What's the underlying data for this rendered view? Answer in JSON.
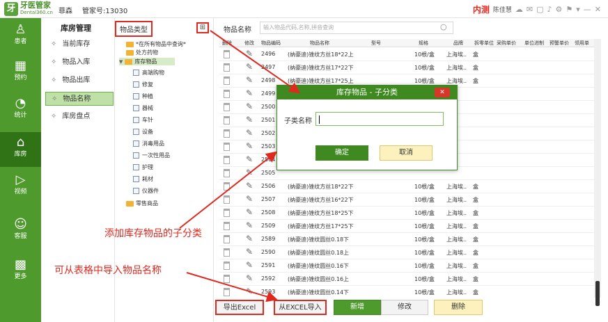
{
  "topbar": {
    "logo_main": "牙医管家",
    "logo_sub": "Dental360.cn",
    "user": "菲森",
    "account": "管家号:13030",
    "env_badge": "内测",
    "username": "陈佳慧",
    "icons": [
      "chat-icon",
      "message-icon",
      "window-icon",
      "bell-icon",
      "settings-icon",
      "signal-icon",
      "wifi-icon",
      "minimize-icon",
      "close-icon"
    ]
  },
  "nav": {
    "items": [
      {
        "label": "患者",
        "icon": "person-icon"
      },
      {
        "label": "预约",
        "icon": "calendar-icon"
      },
      {
        "label": "统计",
        "icon": "pie-chart-icon"
      },
      {
        "label": "库房",
        "icon": "warehouse-icon"
      },
      {
        "label": "视频",
        "icon": "play-icon"
      },
      {
        "label": "客服",
        "icon": "support-icon"
      },
      {
        "label": "更多",
        "icon": "grid-icon"
      }
    ]
  },
  "sub": {
    "title": "库房管理",
    "items": [
      "当前库存",
      "物品入库",
      "物品出库",
      "物品名称",
      "库房盘点"
    ]
  },
  "tree": {
    "title": "物品类型",
    "nodes": [
      {
        "label": "*在所有物品中查询*",
        "type": "folder"
      },
      {
        "label": "处方药物",
        "type": "folder"
      },
      {
        "label": "库存物品",
        "type": "folder"
      },
      {
        "label": "高端购物",
        "type": "page"
      },
      {
        "label": "修复",
        "type": "page"
      },
      {
        "label": "种植",
        "type": "page"
      },
      {
        "label": "器械",
        "type": "page"
      },
      {
        "label": "车针",
        "type": "page"
      },
      {
        "label": "设备",
        "type": "page"
      },
      {
        "label": "消毒用品",
        "type": "page"
      },
      {
        "label": "一次性用品",
        "type": "page"
      },
      {
        "label": "护理",
        "type": "page"
      },
      {
        "label": "耗材",
        "type": "page"
      },
      {
        "label": "仪器件",
        "type": "page"
      },
      {
        "label": "零售商品",
        "type": "folder"
      }
    ]
  },
  "main": {
    "search_label": "物品名称",
    "search_placeholder": "输入物品代码,名称,拼音查询",
    "headers": [
      "删除",
      "修改",
      "物品编码",
      "物品名称",
      "型号",
      "规格",
      "品牌",
      "拆零单位",
      "采购单价",
      "单位进制",
      "预警单价",
      "领用单"
    ],
    "rows": [
      {
        "code": "2496",
        "name": "(纳豪迪)锉纹方丝18*22上",
        "spec": "10根/盒",
        "brand": "上海埃..",
        "unit": "盒"
      },
      {
        "code": "2497",
        "name": "(纳豪迪)锉纹方丝17*22下",
        "spec": "10根/盒",
        "brand": "上海埃..",
        "unit": "盒"
      },
      {
        "code": "2498",
        "name": "(纳豪迪)锉纹方丝17*25上",
        "spec": "10根/盒",
        "brand": "上海埃..",
        "unit": "盒"
      },
      {
        "code": "2499",
        "name": "",
        "spec": "",
        "brand": "",
        "unit": ""
      },
      {
        "code": "2500",
        "name": "",
        "spec": "",
        "brand": "",
        "unit": ""
      },
      {
        "code": "2501",
        "name": "",
        "spec": "",
        "brand": "",
        "unit": ""
      },
      {
        "code": "2502",
        "name": "",
        "spec": "",
        "brand": "",
        "unit": ""
      },
      {
        "code": "2503",
        "name": "",
        "spec": "",
        "brand": "",
        "unit": ""
      },
      {
        "code": "2504",
        "name": "",
        "spec": "",
        "brand": "",
        "unit": ""
      },
      {
        "code": "2505",
        "name": "",
        "spec": "",
        "brand": "",
        "unit": ""
      },
      {
        "code": "2506",
        "name": "(纳豪迪)锉纹方丝18*22下",
        "spec": "10根/盒",
        "brand": "上海埃..",
        "unit": "盒"
      },
      {
        "code": "2507",
        "name": "(纳豪迪)锉纹方丝16*22下",
        "spec": "10根/盒",
        "brand": "上海埃..",
        "unit": "盒"
      },
      {
        "code": "2508",
        "name": "(纳豪迪)锉纹方丝18*25下",
        "spec": "10根/盒",
        "brand": "上海埃..",
        "unit": "盒"
      },
      {
        "code": "2509",
        "name": "(纳豪迪)锉纹方丝17*25下",
        "spec": "10根/盒",
        "brand": "上海埃..",
        "unit": "盒"
      },
      {
        "code": "2589",
        "name": "(纳豪迪)锉纹圆丝0.18下",
        "spec": "10根/盒",
        "brand": "上海埃..",
        "unit": "盒"
      },
      {
        "code": "2590",
        "name": "(纳豪迪)锉纹圆丝0.18上",
        "spec": "10根/盒",
        "brand": "上海埃..",
        "unit": "盒"
      },
      {
        "code": "2591",
        "name": "(纳豪迪)锉纹圆丝0.16下",
        "spec": "10根/盒",
        "brand": "上海埃..",
        "unit": "盒"
      },
      {
        "code": "2592",
        "name": "(纳豪迪)锉纹圆丝0.16上",
        "spec": "10根/盒",
        "brand": "上海埃..",
        "unit": "盒"
      },
      {
        "code": "2593",
        "name": "(纳豪迪)锉纹圆丝0.14下",
        "spec": "10根/盒",
        "brand": "上海埃..",
        "unit": "盒"
      }
    ],
    "buttons": {
      "export": "导出Excel",
      "import": "从EXCEL导入",
      "add": "新增",
      "edit": "修改",
      "delete": "删除"
    }
  },
  "dialog": {
    "title": "库存物品 - 子分类",
    "field_label": "子类名称",
    "ok": "确定",
    "cancel": "取消"
  },
  "annotations": {
    "subcategory": "添加库存物品的子分类",
    "import": "可从表格中导入物品名称"
  }
}
